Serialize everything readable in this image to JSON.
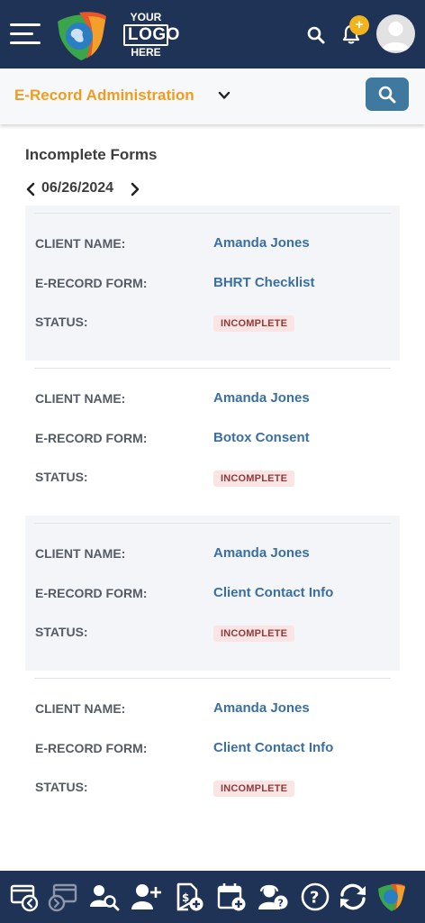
{
  "header": {
    "logo_text": {
      "line1": "YOUR",
      "line2": "LOGO",
      "line3": "HERE"
    },
    "notification_badge": "+",
    "icons": [
      "menu-icon",
      "logo-emblem-icon",
      "search-icon",
      "bell-icon",
      "user-avatar-icon"
    ]
  },
  "subheader": {
    "module_title": "E-Record Administration",
    "icons": [
      "chevron-down-icon",
      "search-icon"
    ]
  },
  "main": {
    "section_title": "Incomplete Forms",
    "date": "06/26/2024",
    "labels": {
      "client": "CLIENT NAME:",
      "form": "E-RECORD FORM:",
      "status": "STATUS:"
    },
    "records": [
      {
        "client_name": "Amanda Jones",
        "form": "BHRT Checklist",
        "status": "INCOMPLETE"
      },
      {
        "client_name": "Amanda Jones",
        "form": "Botox Consent",
        "status": "INCOMPLETE"
      },
      {
        "client_name": "Amanda Jones",
        "form": "Client Contact Info",
        "status": "INCOMPLETE"
      },
      {
        "client_name": "Amanda Jones",
        "form": "Client Contact Info",
        "status": "INCOMPLETE"
      }
    ]
  },
  "bottom_nav": {
    "icons": [
      "checkout-icon",
      "checkin-icon",
      "client-search-icon",
      "add-client-icon",
      "add-invoice-icon",
      "add-appointment-icon",
      "support-icon",
      "help-icon",
      "refresh-icon",
      "app-logo-icon"
    ]
  },
  "colors": {
    "nav_bg": "#1f3356",
    "accent_orange": "#f29c1f",
    "link_blue": "#3a6fa0",
    "button_blue": "#3f79a0",
    "badge_bg": "#fbe4e4",
    "badge_text": "#8f3b3b",
    "notification_yellow": "#f2b41e"
  }
}
